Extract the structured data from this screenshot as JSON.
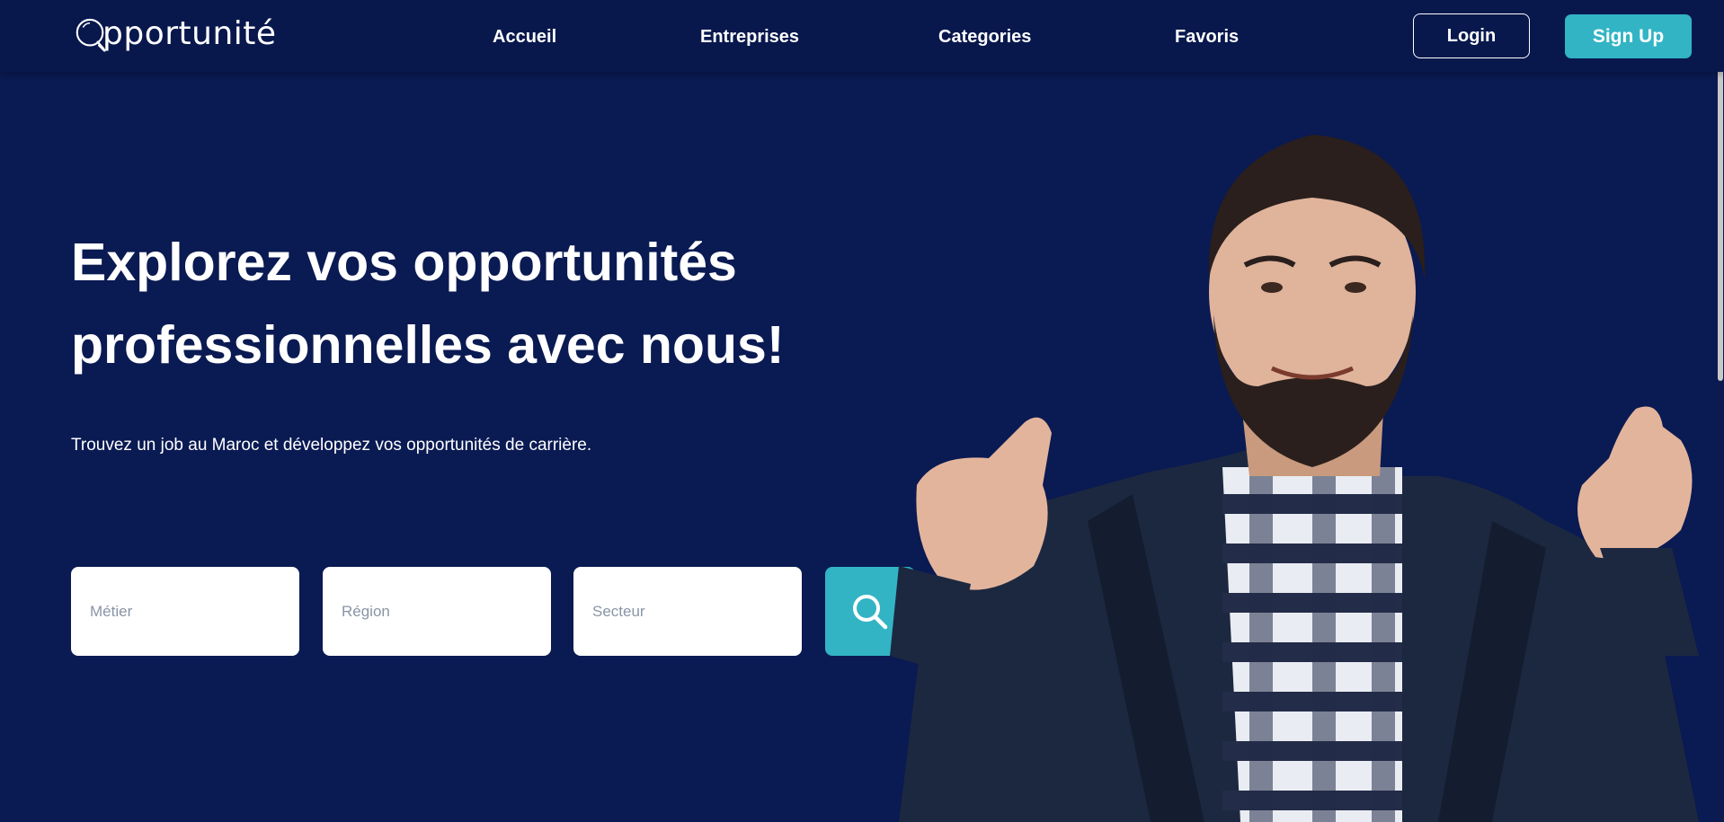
{
  "brand": {
    "logo_text": "pportunité"
  },
  "nav": {
    "items": [
      {
        "label": "Accueil"
      },
      {
        "label": "Entreprises"
      },
      {
        "label": "Categories"
      },
      {
        "label": "Favoris"
      }
    ],
    "login_label": "Login",
    "signup_label": "Sign Up"
  },
  "hero": {
    "title_line1": "Explorez vos opportunités",
    "title_line2": "professionnelles avec nous!",
    "subtitle": "Trouvez un job au Maroc et développez vos opportunités de carrière."
  },
  "search": {
    "metier_placeholder": "Métier",
    "region_placeholder": "Région",
    "secteur_placeholder": "Secteur",
    "button_icon": "search-icon"
  },
  "colors": {
    "background": "#0a1a52",
    "header": "#08184d",
    "accent": "#32b4c5",
    "text": "#ffffff"
  }
}
